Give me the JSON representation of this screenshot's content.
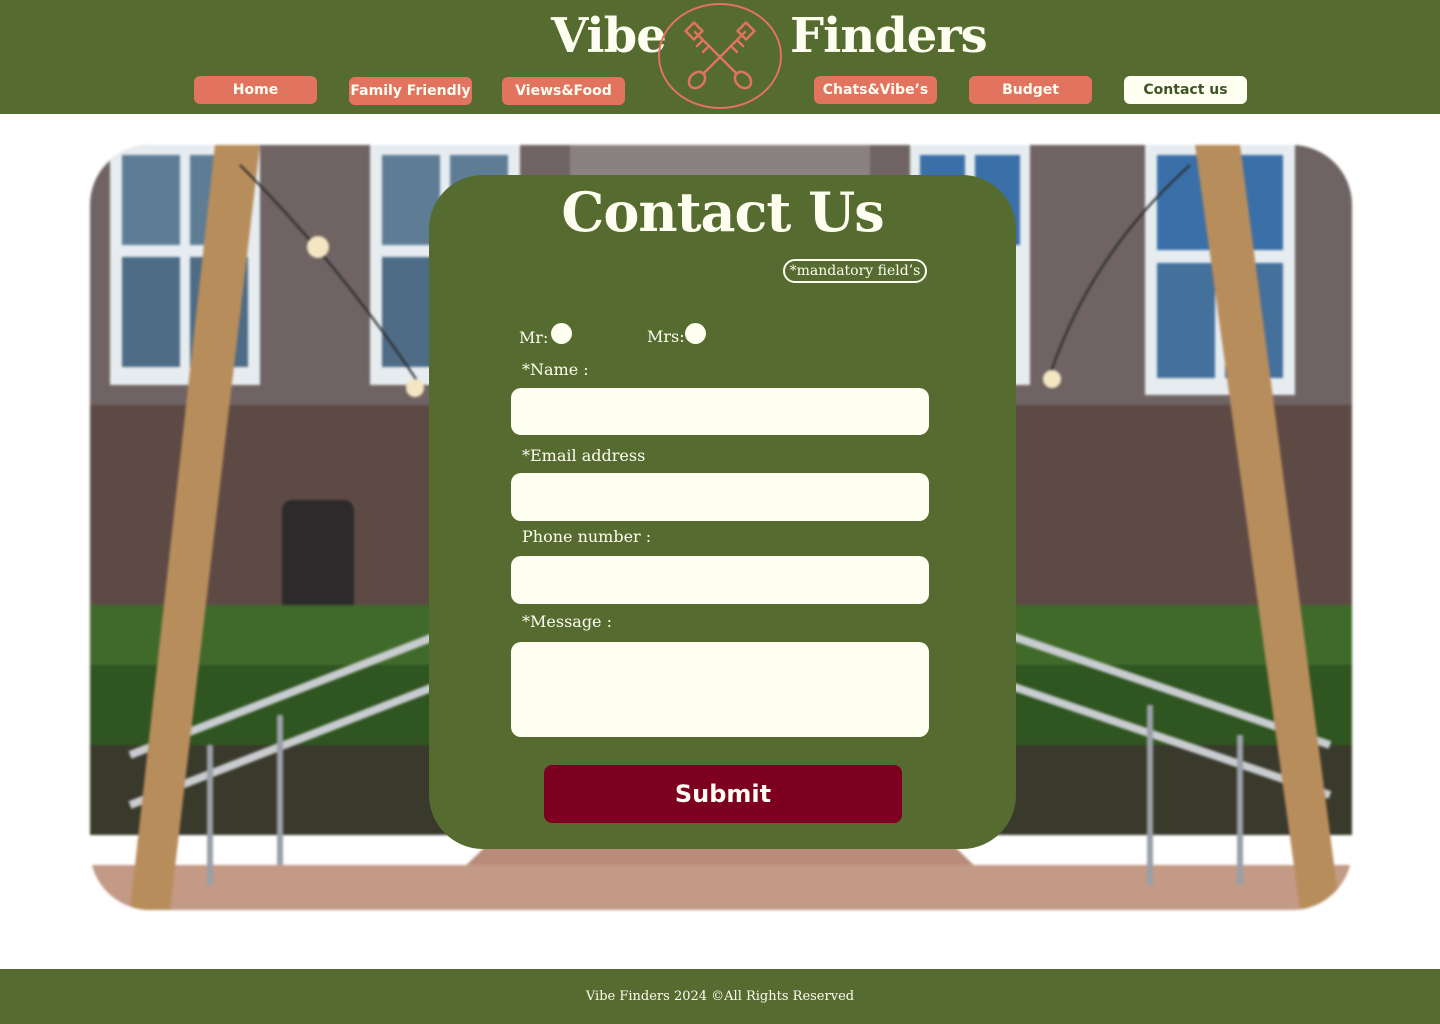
{
  "header": {
    "brand_left": "Vibe",
    "brand_right": "Finders",
    "logo_icon": "crossed-keys-icon",
    "nav": [
      {
        "label": "Home"
      },
      {
        "label": "Family Friendly"
      },
      {
        "label": "Views&Food"
      },
      {
        "label": "Chats&Vibe’s"
      },
      {
        "label": "Budget"
      },
      {
        "label": "Contact us",
        "active": true
      }
    ]
  },
  "hero": {
    "image_icon": "bridge-photo"
  },
  "form": {
    "title": "Contact Us",
    "mandatory_note": "*mandatory field’s",
    "salutations": [
      {
        "label": "Mr:"
      },
      {
        "label": "Mrs:"
      }
    ],
    "name_label": "*Name :",
    "name_value": "",
    "email_label": "*Email address",
    "email_value": "",
    "phone_label": "Phone number :",
    "phone_value": "",
    "message_label": "*Message :",
    "message_value": "",
    "submit_label": "Submit"
  },
  "footer": {
    "text": "Vibe Finders 2024 ©All Rights Reserved"
  },
  "colors": {
    "brand_green": "#556b2f",
    "nav_coral": "#e1735f",
    "cream": "#fefff0",
    "submit_maroon": "#7e0020"
  }
}
